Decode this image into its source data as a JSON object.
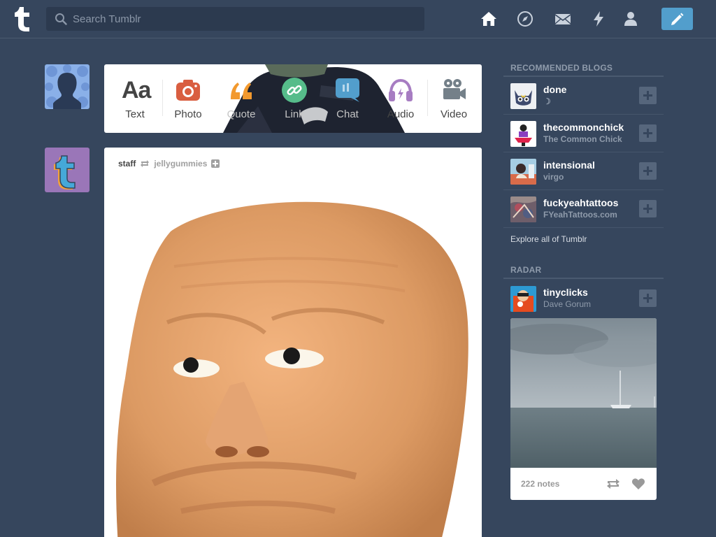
{
  "header": {
    "logo": "t",
    "search_placeholder": "Search Tumblr",
    "nav_icons": [
      "home-icon",
      "compass-icon",
      "mail-icon",
      "lightning-icon",
      "account-icon"
    ],
    "compose_icon": "pencil-icon",
    "compose_color": "#529ecc"
  },
  "post_types": [
    {
      "label": "Text",
      "icon": "text-icon",
      "color": "#444444"
    },
    {
      "label": "Photo",
      "icon": "camera-icon",
      "color": "#d95e40"
    },
    {
      "label": "Quote",
      "icon": "quote-icon",
      "color": "#f2992e"
    },
    {
      "label": "Link",
      "icon": "link-icon",
      "color": "#56bc8a"
    },
    {
      "label": "Chat",
      "icon": "chat-icon",
      "color": "#529ecc"
    },
    {
      "label": "Audio",
      "icon": "headphones-icon",
      "color": "#a77dc2"
    },
    {
      "label": "Video",
      "icon": "video-camera-icon",
      "color": "#748089"
    }
  ],
  "post": {
    "blog": "staff",
    "reblogged_from": "jellygummies"
  },
  "sidebar": {
    "recommended_title": "RECOMMENDED BLOGS",
    "blogs": [
      {
        "name": "done",
        "subtitle": "☽"
      },
      {
        "name": "thecommonchick",
        "subtitle": "The Common Chick"
      },
      {
        "name": "intensional",
        "subtitle": "virgo"
      },
      {
        "name": "fuckyeahtattoos",
        "subtitle": "FYeahTattoos.com"
      }
    ],
    "explore": "Explore all of Tumblr",
    "radar_title": "RADAR",
    "radar": {
      "name": "tinyclicks",
      "subtitle": "Dave Gorum",
      "notes": "222 notes"
    }
  }
}
